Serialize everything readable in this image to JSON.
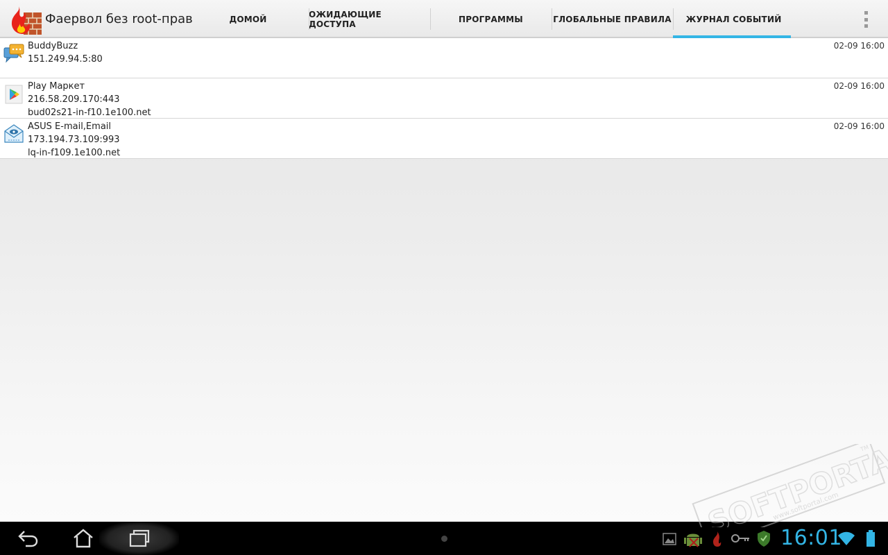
{
  "app": {
    "title": "Фаервол без root-прав",
    "icon": "firewall-flame-icon"
  },
  "tabs": [
    {
      "label": "ДОМОЙ",
      "active": false
    },
    {
      "label": "ОЖИДАЮЩИЕ ДОСТУПА",
      "active": false
    },
    {
      "label": "ПРОГРАММЫ",
      "active": false
    },
    {
      "label": "ГЛОБАЛЬНЫЕ ПРАВИЛА",
      "active": false
    },
    {
      "label": "ЖУРНАЛ СОБЫТИЙ",
      "active": true
    }
  ],
  "overflow_menu": {
    "icon": "overflow-menu-icon"
  },
  "log": [
    {
      "app": "BuddyBuzz",
      "address": "151.249.94.5:80",
      "host": "",
      "time": "02-09 16:00",
      "icon": "chat-bubbles-icon"
    },
    {
      "app": "Play Маркет",
      "address": "216.58.209.170:443",
      "host": "bud02s21-in-f10.1e100.net",
      "time": "02-09 16:00",
      "icon": "play-store-icon"
    },
    {
      "app": "ASUS E-mail,Email",
      "address": "173.194.73.109:993",
      "host": "lq-in-f109.1e100.net",
      "time": "02-09 16:00",
      "icon": "email-envelope-icon"
    }
  ],
  "status_bar": {
    "clock": "16:01",
    "icons": [
      "gallery-icon",
      "android-debug-icon",
      "flame-icon",
      "key-icon",
      "shield-icon",
      "wifi-icon",
      "battery-icon"
    ]
  },
  "navigation": [
    "back-icon",
    "home-icon",
    "recent-apps-icon"
  ],
  "colors": {
    "accent": "#33b5e5",
    "actionbar": "#ececec",
    "navbar": "#000000"
  },
  "watermark": {
    "brand": "SOFTPORTAL",
    "url": "www.softportal.com",
    "tm": "TM"
  }
}
